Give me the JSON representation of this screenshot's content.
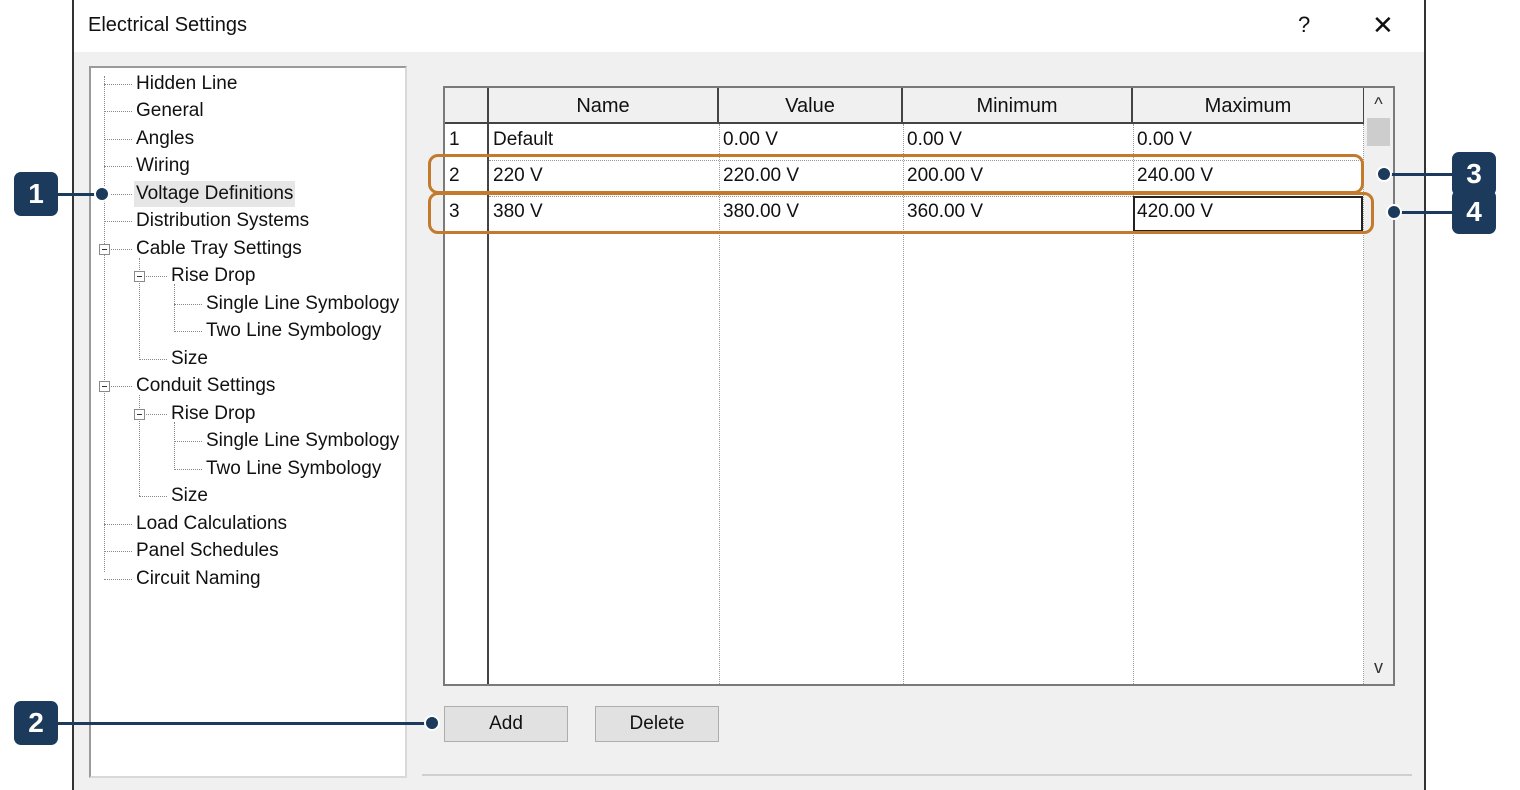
{
  "window": {
    "title": "Electrical Settings",
    "help_label": "?",
    "close_label": "✕"
  },
  "tree": {
    "items": [
      {
        "label": "Hidden Line"
      },
      {
        "label": "General"
      },
      {
        "label": "Angles"
      },
      {
        "label": "Wiring"
      },
      {
        "label": "Voltage Definitions",
        "selected": true
      },
      {
        "label": "Distribution Systems"
      },
      {
        "label": "Cable Tray Settings"
      },
      {
        "label": "Rise Drop"
      },
      {
        "label": "Single Line Symbology"
      },
      {
        "label": "Two Line Symbology"
      },
      {
        "label": "Size"
      },
      {
        "label": "Conduit Settings"
      },
      {
        "label": "Rise Drop"
      },
      {
        "label": "Single Line Symbology"
      },
      {
        "label": "Two Line Symbology"
      },
      {
        "label": "Size"
      },
      {
        "label": "Load Calculations"
      },
      {
        "label": "Panel Schedules"
      },
      {
        "label": "Circuit Naming"
      }
    ]
  },
  "table": {
    "columns": [
      "Name",
      "Value",
      "Minimum",
      "Maximum"
    ],
    "rows": [
      {
        "num": "1",
        "name": "Default",
        "value": "0.00 V",
        "minimum": "0.00 V",
        "maximum": "0.00 V"
      },
      {
        "num": "2",
        "name": "220 V",
        "value": "220.00 V",
        "minimum": "200.00 V",
        "maximum": "240.00 V"
      },
      {
        "num": "3",
        "name": "380 V",
        "value": "380.00 V",
        "minimum": "360.00 V",
        "maximum": "420.00 V"
      }
    ]
  },
  "scroll": {
    "up": "^",
    "down": "v"
  },
  "buttons": {
    "add": "Add",
    "delete": "Delete"
  },
  "callouts": {
    "c1": "1",
    "c2": "2",
    "c3": "3",
    "c4": "4"
  },
  "colors": {
    "callout": "#1b3a5c",
    "highlight": "#c47a2c"
  }
}
